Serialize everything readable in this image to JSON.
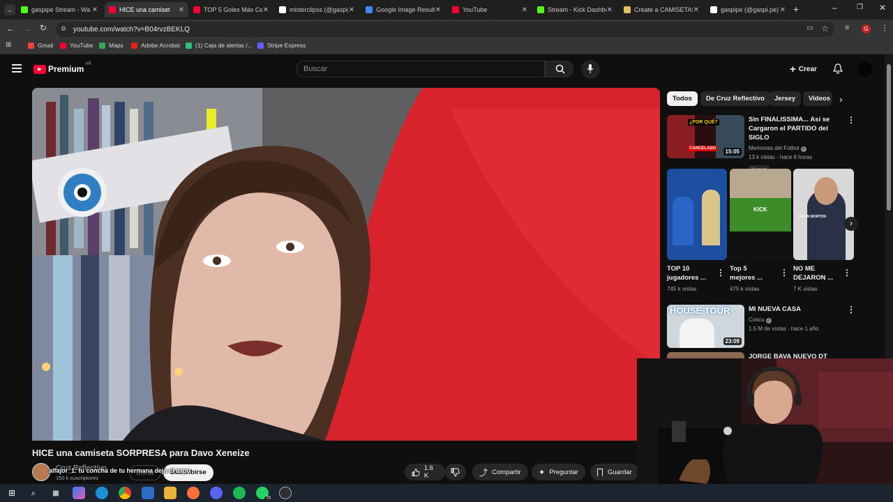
{
  "browser": {
    "tabs": [
      {
        "title": "gaspipe Stream - Wa",
        "icon": "kick-icon",
        "color": "#53fc18"
      },
      {
        "title": "HICE una camiset",
        "icon": "youtube-icon",
        "color": "#ff0033",
        "active": true
      },
      {
        "title": "TOP 5 Goles Más Cele",
        "icon": "youtube-icon",
        "color": "#ff0033"
      },
      {
        "title": "misterclipss (@gaspip",
        "icon": "tiktok-icon",
        "color": "#ffffff"
      },
      {
        "title": "Google Image Result",
        "icon": "google-icon",
        "color": "#4285f4"
      },
      {
        "title": "YouTube",
        "icon": "youtube-icon",
        "color": "#ff0033"
      },
      {
        "title": "Stream - Kick Dashbo",
        "icon": "kick-icon",
        "color": "#53fc18"
      },
      {
        "title": "Create a CAMISETAS",
        "icon": "doc-icon",
        "color": "#e0c060"
      },
      {
        "title": "gaspipe (@gaspi.pe)",
        "icon": "tiktok-icon",
        "color": "#ffffff"
      }
    ],
    "url": "youtube.com/watch?v=B04rvzBEKLQ",
    "profile_initial": "G",
    "bookmarks": [
      {
        "label": "Gmail",
        "color": "#ea4335"
      },
      {
        "label": "YouTube",
        "color": "#ff0033"
      },
      {
        "label": "Maps",
        "color": "#34a853"
      },
      {
        "label": "Adobe Acrobat",
        "color": "#e2231a"
      },
      {
        "label": "(1) Caja de alertas /...",
        "color": "#2ec27e"
      },
      {
        "label": "Stripe Express",
        "color": "#635bff"
      }
    ]
  },
  "youtube": {
    "logo_text": "Premium",
    "region": "AR",
    "search_placeholder": "Buscar",
    "create_label": "Crear",
    "video": {
      "title": "HICE una camiseta SORPRESA para Davo Xeneize",
      "channel": "Cruz Reflectivo",
      "subscribers": "150 k suscriptores",
      "join_label": "Unirse",
      "subscribe_label": "Suscribirse",
      "likes": "1.6 K",
      "share_label": "Compartir",
      "ask_label": "Preguntar",
      "save_label": "Guardar",
      "overlay_user": "alfajor_1",
      "overlay_message": "tu concha de tu hermana deja el vapo"
    },
    "chips": [
      "Todos",
      "De Cruz Reflectivo",
      "Jersey",
      "Videos"
    ],
    "recommendations": [
      {
        "title_line1": "Sin FINALISSIMA... Así se",
        "title_line2": "Cargaron el PARTIDO del SIGLO",
        "channel": "Memorias del Fútbol",
        "meta": "13 k vistas · hace 6 horas",
        "badge": "Nuevo",
        "duration": "15:05",
        "thumb_text": "¿POR QUÉ?",
        "thumb_text2": "CANCELADO"
      },
      {
        "title_line1": "MI NUEVA CASA",
        "channel": "Coscu",
        "meta": "1.5 M de vistas · hace 1 año",
        "duration": "23:09",
        "thumb_text": "HOUSE TOUR"
      },
      {
        "title_line1": "JORGE BAVA NUEVO DT"
      }
    ],
    "shorts": [
      {
        "title_line1": "TOP 10",
        "title_line2": "jugadores ...",
        "views": "745 k vistas"
      },
      {
        "title_line1": "Top 5",
        "title_line2": "mejores ...",
        "views": "475 k vistas",
        "thumb_text": "KICK"
      },
      {
        "title_line1": "NO ME",
        "title_line2": "DEJARON ...",
        "views": "7 K vistas",
        "thumb_text": "ES UN MORTON"
      }
    ]
  },
  "taskbar": {
    "whatsapp_badge": "70"
  }
}
